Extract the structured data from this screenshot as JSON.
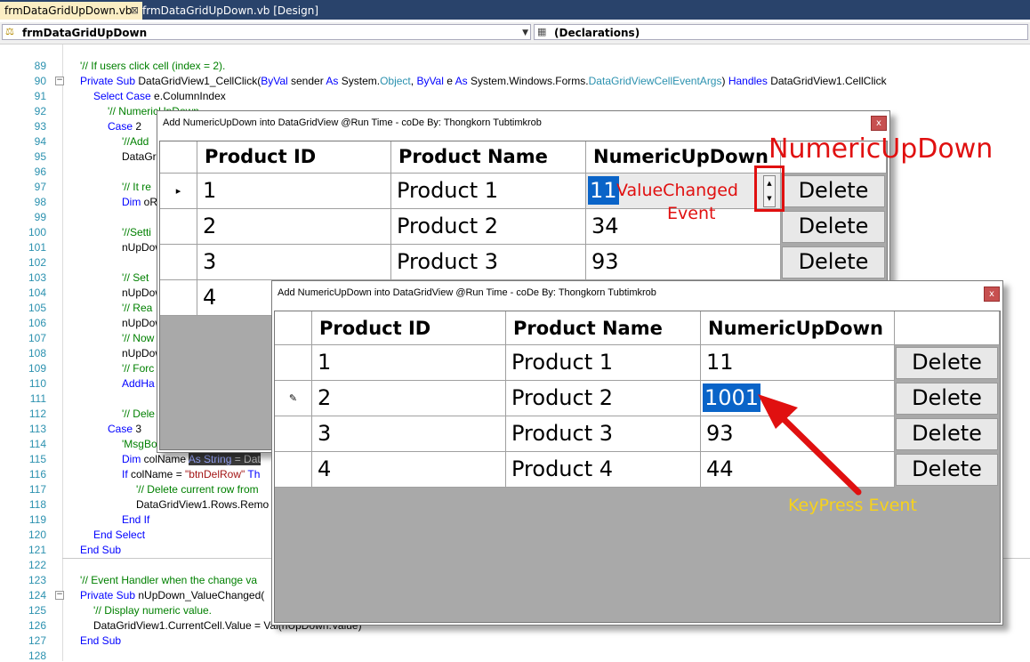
{
  "tabs": [
    {
      "label": "frmDataGridUpDown.vb",
      "close": "⊠"
    },
    {
      "label": "frmDataGridUpDown.vb [Design]"
    }
  ],
  "nav": {
    "class_combo": "frmDataGridUpDown",
    "member_combo": "(Declarations)"
  },
  "code_lines": [
    {
      "n": "89"
    },
    {
      "n": "90"
    },
    {
      "n": "91"
    },
    {
      "n": "92"
    },
    {
      "n": "93"
    },
    {
      "n": "94"
    },
    {
      "n": "95"
    },
    {
      "n": "96"
    },
    {
      "n": "97"
    },
    {
      "n": "98"
    },
    {
      "n": "99"
    },
    {
      "n": "100"
    },
    {
      "n": "101"
    },
    {
      "n": "102"
    },
    {
      "n": "103"
    },
    {
      "n": "104"
    },
    {
      "n": "105"
    },
    {
      "n": "106"
    },
    {
      "n": "107"
    },
    {
      "n": "108"
    },
    {
      "n": "109"
    },
    {
      "n": "110"
    },
    {
      "n": "111"
    },
    {
      "n": "112"
    },
    {
      "n": "113"
    },
    {
      "n": "114"
    },
    {
      "n": "115"
    },
    {
      "n": "116"
    },
    {
      "n": "117"
    },
    {
      "n": "118"
    },
    {
      "n": "119"
    },
    {
      "n": "120"
    },
    {
      "n": "121"
    },
    {
      "n": "122"
    },
    {
      "n": "123"
    },
    {
      "n": "124"
    },
    {
      "n": "125"
    },
    {
      "n": "126"
    },
    {
      "n": "127"
    },
    {
      "n": "128"
    }
  ],
  "code": {
    "l90": "'// If users click cell (index = 2).",
    "l91a": "Private Sub ",
    "l91b": "DataGridView1_CellClick(",
    "l91c": "ByVal",
    "l91d": " sender ",
    "l91e": "As",
    "l91f": " System.",
    "l91g": "Object",
    "l91h": ", ",
    "l91i": "ByVal",
    "l91j": " e ",
    "l91k": "As",
    "l91l": " System.Windows.Forms.",
    "l91m": "DataGridViewCellEventArgs",
    "l91n": ") ",
    "l91o": "Handles",
    "l91p": " DataGridView1.CellClick",
    "l92a": "Select Case",
    "l92b": " e.ColumnIndex",
    "l93": "'// NumericUpDown",
    "l94a": "Case",
    "l94b": " 2",
    "l95": "'//Add",
    "l96": "DataGri",
    "l98": "'// It re",
    "l99a": "Dim",
    "l99b": " oR",
    "l101": "'//Setti",
    "l102": "nUpDow",
    "l104": "'// Set",
    "l105": "nUpDow",
    "l106": "'// Rea",
    "l107": "nUpDow",
    "l108": "'// Now",
    "l109": "nUpDow",
    "l110": "'// Forc",
    "l111": "AddHa",
    "l113": "'// Dele",
    "l114a": "Case",
    "l114b": " 3",
    "l115": "'MsgBo",
    "l116a": "Dim",
    "l116b": " colName ",
    "l116c": "As String",
    "l116d": " = Dat",
    "l117a": "If",
    "l117b": " colName = ",
    "l117c": "\"btnDelRow\"",
    "l117d": " Th",
    "l118": "'// Delete current row from",
    "l119": "DataGridView1.Rows.Remo",
    "l120": "End If",
    "l121": "End Select",
    "l122": "End Sub",
    "l124": "'// Event Handler when the change va",
    "l125a": "Private Sub",
    "l125b": " nUpDown_ValueChanged(",
    "l126": "'// Display numeric value.",
    "l127a": "DataGridView1.CurrentCell.Value = ",
    "l127b": "Val(nUpDown.Value)",
    "l128": "End Sub"
  },
  "form1": {
    "title": "Add NumericUpDown into DataGridView @Run Time - coDe By: Thongkorn Tubtimkrob",
    "close": "x",
    "headers": [
      "Product ID",
      "Product Name",
      "NumericUpDown"
    ],
    "rows": [
      {
        "id": "1",
        "name": "Product 1",
        "num": "11",
        "btn": "Delete",
        "marker": "▸"
      },
      {
        "id": "2",
        "name": "Product 2",
        "num": "34",
        "btn": "Delete"
      },
      {
        "id": "3",
        "name": "Product 3",
        "num": "93",
        "btn": "Delete"
      },
      {
        "id": "4"
      }
    ]
  },
  "form2": {
    "title": "Add NumericUpDown into DataGridView @Run Time - coDe By: Thongkorn Tubtimkrob",
    "close": "x",
    "headers": [
      "Product ID",
      "Product Name",
      "NumericUpDown"
    ],
    "rows": [
      {
        "id": "1",
        "name": "Product 1",
        "num": "11",
        "btn": "Delete"
      },
      {
        "id": "2",
        "name": "Product 2",
        "num": "1001",
        "btn": "Delete",
        "marker": "✎"
      },
      {
        "id": "3",
        "name": "Product 3",
        "num": "93",
        "btn": "Delete"
      },
      {
        "id": "4",
        "name": "Product 4",
        "num": "44",
        "btn": "Delete"
      }
    ]
  },
  "annotations": {
    "numeric_updown": "NumericUpDown",
    "value_changed_1": "ValueChanged",
    "value_changed_2": "Event",
    "keypress": "KeyPress Event"
  },
  "colors": {
    "annotation_red": "#e01010",
    "annotation_yellow": "#f7d21c",
    "selection_blue": "#0a64c8"
  }
}
